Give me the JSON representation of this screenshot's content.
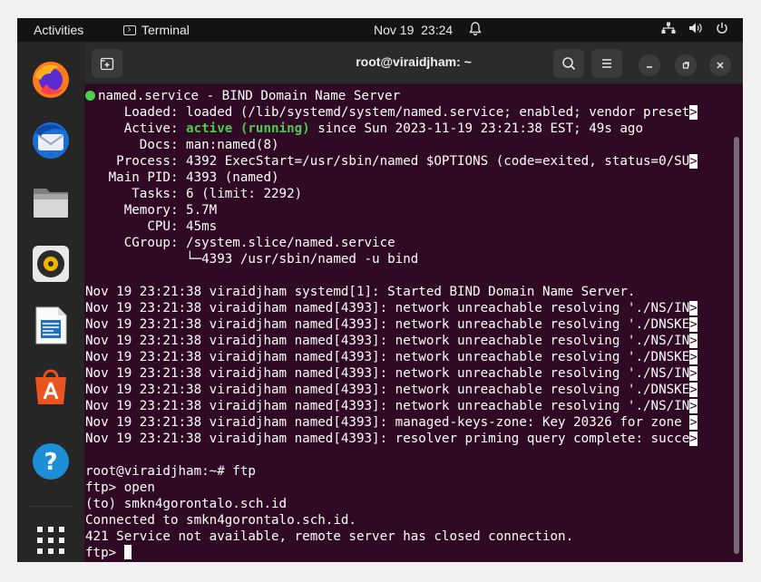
{
  "topbar": {
    "activities": "Activities",
    "app_name": "Terminal",
    "datetime": "Nov 19  23:24"
  },
  "dock": {
    "apps": [
      "Firefox",
      "Thunderbird Mail",
      "Files",
      "Rhythmbox",
      "LibreOffice Writer",
      "Ubuntu Software",
      "Help",
      "Show Applications"
    ]
  },
  "terminal": {
    "title": "root@viraidjham: ~",
    "status": {
      "service": "named.service - BIND Domain Name Server",
      "loaded": "     Loaded: loaded (/lib/systemd/system/named.service; enabled; vendor preset",
      "active_prefix": "     Active: ",
      "active_state": "active (running)",
      "active_suffix": " since Sun 2023-11-19 23:21:38 EST; 49s ago",
      "docs": "       Docs: man:named(8)",
      "process": "    Process: 4392 ExecStart=/usr/sbin/named $OPTIONS (code=exited, status=0/SU",
      "main_pid": "   Main PID: 4393 (named)",
      "tasks": "      Tasks: 6 (limit: 2292)",
      "memory": "     Memory: 5.7M",
      "cpu": "        CPU: 45ms",
      "cgroup": "     CGroup: /system.slice/named.service",
      "cgroup_child": "             └─4393 /usr/sbin/named -u bind"
    },
    "logs": [
      {
        "text": "Nov 19 23:21:38 viraidjham systemd[1]: Started BIND Domain Name Server.",
        "truncated": false
      },
      {
        "text": "Nov 19 23:21:38 viraidjham named[4393]: network unreachable resolving './NS/IN",
        "truncated": true
      },
      {
        "text": "Nov 19 23:21:38 viraidjham named[4393]: network unreachable resolving './DNSKE",
        "truncated": true
      },
      {
        "text": "Nov 19 23:21:38 viraidjham named[4393]: network unreachable resolving './NS/IN",
        "truncated": true
      },
      {
        "text": "Nov 19 23:21:38 viraidjham named[4393]: network unreachable resolving './DNSKE",
        "truncated": true
      },
      {
        "text": "Nov 19 23:21:38 viraidjham named[4393]: network unreachable resolving './NS/IN",
        "truncated": true
      },
      {
        "text": "Nov 19 23:21:38 viraidjham named[4393]: network unreachable resolving './DNSKE",
        "truncated": true
      },
      {
        "text": "Nov 19 23:21:38 viraidjham named[4393]: network unreachable resolving './NS/IN",
        "truncated": true
      },
      {
        "text": "Nov 19 23:21:38 viraidjham named[4393]: managed-keys-zone: Key 20326 for zone ",
        "truncated": true
      },
      {
        "text": "Nov 19 23:21:38 viraidjham named[4393]: resolver priming query complete: succe",
        "truncated": true
      }
    ],
    "truncation_marker": ">",
    "session": [
      "root@viraidjham:~# ftp",
      "ftp> open",
      "(to) smkn4gorontalo.sch.id",
      "Connected to smkn4gorontalo.sch.id.",
      "421 Service not available, remote server has closed connection."
    ],
    "prompt": "ftp> "
  }
}
